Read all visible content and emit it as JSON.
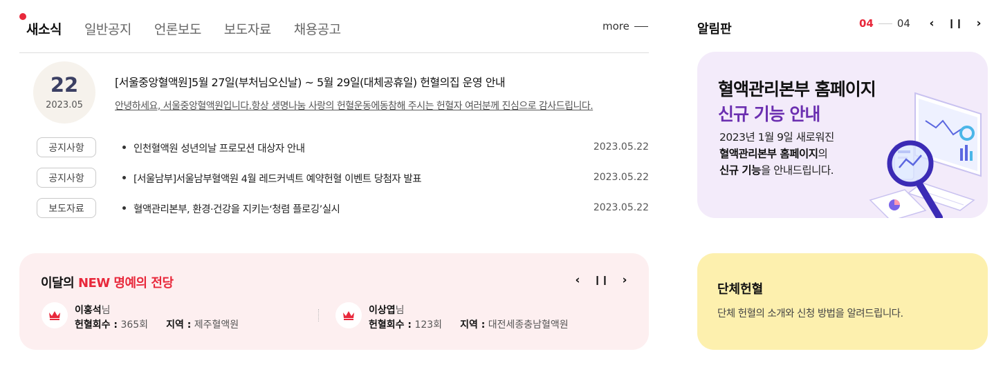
{
  "news": {
    "tabs": [
      "새소식",
      "일반공지",
      "언론보도",
      "보도자료",
      "채용공고"
    ],
    "more_label": "more",
    "featured": {
      "day": "22",
      "year_month": "2023.05",
      "title": "[서울중앙혈액원]5월 27일(부처님오신날) ~ 5월 29일(대체공휴일) 헌혈의집 운영 안내",
      "summary": "안녕하세요, 서울중앙혈액원입니다.항상 생명나눔 사랑의 헌혈운동에동참해 주시는 헌혈자 여러분께 진심으로 감사드립니다."
    },
    "items": [
      {
        "category": "공지사항",
        "title": "인천혈액원 성년의날 프로모션 대상자 안내",
        "date": "2023.05.22"
      },
      {
        "category": "공지사항",
        "title": "[서울남부]서울남부혈액원 4월 레드커넥트 예약헌혈 이벤트 당첨자 발표",
        "date": "2023.05.22"
      },
      {
        "category": "보도자료",
        "title": "혈액관리본부, 환경·건강을 지키는‘청렴 플로깅’실시",
        "date": "2023.05.22"
      }
    ]
  },
  "fame": {
    "title_prefix": "이달의 ",
    "title_highlight": "NEW 명예의 전당",
    "donors": [
      {
        "name": "이홍석",
        "suffix": "님",
        "count_label": "헌혈회수 :",
        "count": "365회",
        "region_label": "지역 :",
        "region": "제주혈액원"
      },
      {
        "name": "이상엽",
        "suffix": "님",
        "count_label": "헌혈회수 :",
        "count": "123회",
        "region_label": "지역 :",
        "region": "대전세종충남혈액원"
      }
    ]
  },
  "board": {
    "title": "알림판",
    "current": "04",
    "total": "04",
    "banner": {
      "line1": "혈액관리본부 홈페이지",
      "line2": "신규 기능 안내",
      "desc1": "2023년 1월 9일 새로워진",
      "desc2_bold": "혈액관리본부 홈페이지",
      "desc2_rest": "의",
      "desc3_bold": "신규 기능",
      "desc3_rest": "을 안내드립니다."
    }
  },
  "group_donation": {
    "title": "단체헌혈",
    "description": "단체 헌혈의 소개와 신청 방법을 알려드립니다."
  },
  "icons": {
    "prev": "‹",
    "pause": "❙❙",
    "next": "›"
  },
  "colors": {
    "accent_red": "#e8283b",
    "accent_purple": "#6b2fb0",
    "fame_bg": "#fdeff0",
    "board_bg": "#f3ebfa",
    "group_bg": "#fdf0ae"
  }
}
